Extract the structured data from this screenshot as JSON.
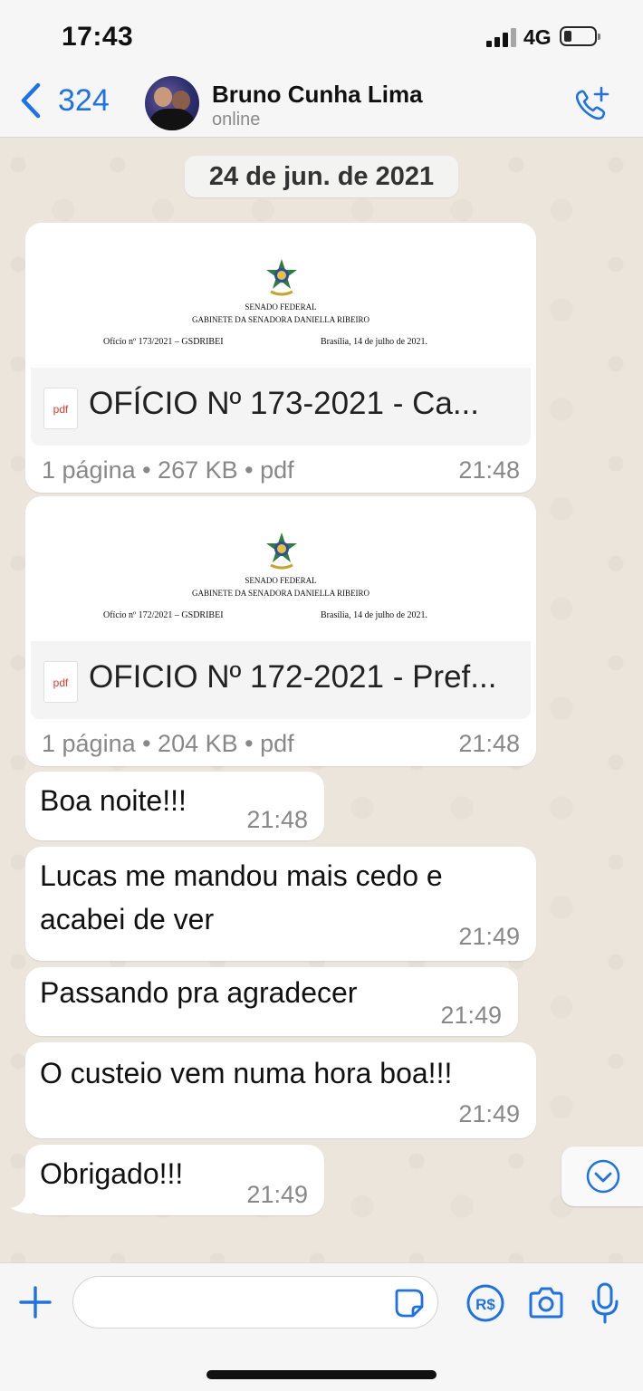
{
  "status_bar": {
    "time": "17:43",
    "network": "4G",
    "battery_level": 0.25
  },
  "header": {
    "back_count": "324",
    "contact_name": "Bruno Cunha Lima",
    "contact_status": "online",
    "call_icon": "phone-plus-icon",
    "accent_color": "#1e72e8"
  },
  "chat": {
    "date_label": "24 de jun. de 2021",
    "documents": [
      {
        "preview_line1": "SENADO FEDERAL",
        "preview_line2": "GABINETE DA SENADORA DANIELLA RIBEIRO",
        "preview_ref": "Ofício nº 173/2021 – GSDRIBEI",
        "preview_date": "Brasília, 14 de julho de 2021.",
        "icon_label": "pdf",
        "file_name": "OFÍCIO Nº 173-2021 - Ca...",
        "meta": "1 página • 267 KB • pdf",
        "time": "21:48"
      },
      {
        "preview_line1": "SENADO FEDERAL",
        "preview_line2": "GABINETE DA SENADORA DANIELLA RIBEIRO",
        "preview_ref": "Ofício nº 172/2021 – GSDRIBEI",
        "preview_date": "Brasília, 14 de julho de 2021.",
        "icon_label": "pdf",
        "file_name": "OFICIO Nº 172-2021 - Pref...",
        "meta": "1 página • 204 KB • pdf",
        "time": "21:48"
      }
    ],
    "messages": [
      {
        "lines": [
          "Boa noite!!!"
        ],
        "time": "21:48"
      },
      {
        "lines": [
          "Lucas me mandou mais cedo e",
          "acabei de ver"
        ],
        "time": "21:49"
      },
      {
        "lines": [
          "Passando pra agradecer"
        ],
        "time": "21:49"
      },
      {
        "lines": [
          "O custeio vem numa hora boa!!!"
        ],
        "time": "21:49"
      },
      {
        "lines": [
          "Obrigado!!!"
        ],
        "time": "21:49"
      }
    ]
  },
  "input_bar": {
    "placeholder": "",
    "pix_label": "R$"
  }
}
